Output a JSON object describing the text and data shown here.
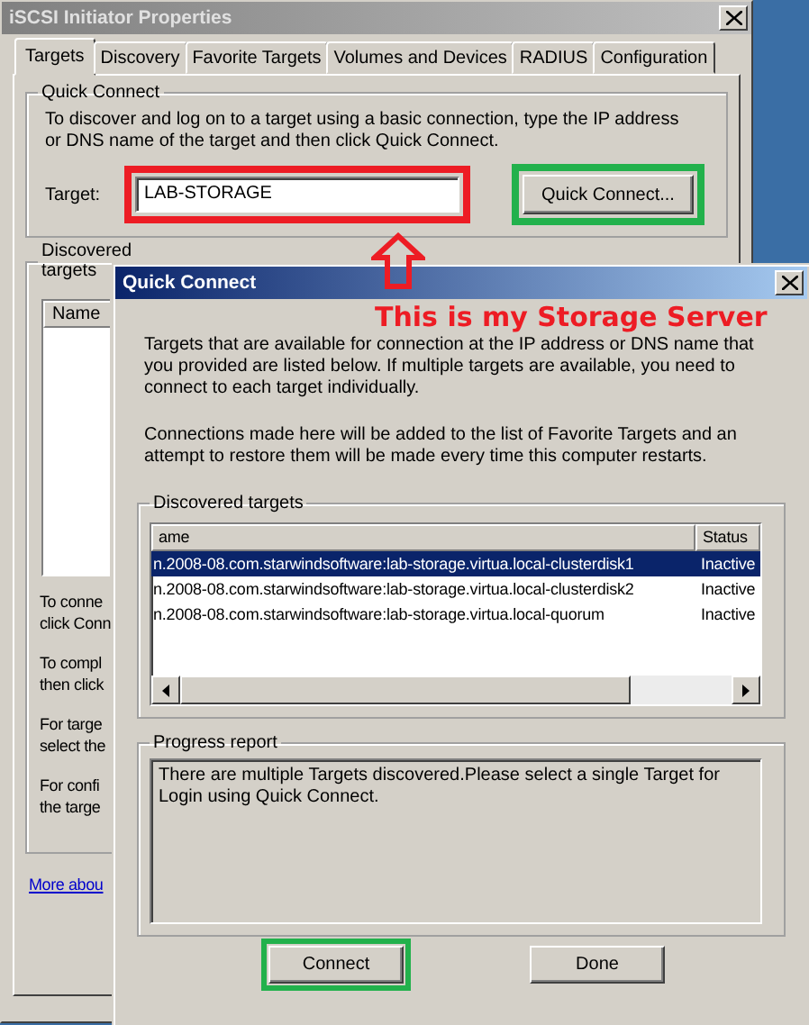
{
  "main_window": {
    "title": "iSCSI Initiator Properties",
    "tabs": [
      {
        "label": "Targets",
        "selected": true
      },
      {
        "label": "Discovery",
        "selected": false
      },
      {
        "label": "Favorite Targets",
        "selected": false
      },
      {
        "label": "Volumes and Devices",
        "selected": false
      },
      {
        "label": "RADIUS",
        "selected": false
      },
      {
        "label": "Configuration",
        "selected": false
      }
    ],
    "quick_connect": {
      "legend": "Quick Connect",
      "description": "To discover and log on to a target using a basic connection, type the IP address or DNS name of the target and then click Quick Connect.",
      "target_label": "Target:",
      "target_value": "LAB-STORAGE",
      "target_highlight": {
        "color": "#ed1c24"
      },
      "button": "Quick Connect...",
      "button_highlight": {
        "color": "#22b14c"
      }
    },
    "discovered_targets": {
      "legend": "Discovered targets",
      "column": "Name",
      "notes": [
        "To conne\nclick Conn",
        "To compl\nthen click",
        "For targe\nselect the",
        "For confi\nthe targe"
      ]
    },
    "link": "More abou"
  },
  "quick_connect_dialog": {
    "title": "Quick Connect",
    "intro": "Targets that are available for connection at the IP address or DNS name that you provided are listed below.  If multiple targets are available, you need to connect to each target individually.",
    "note": "Connections made here will be added to the list of Favorite Targets and an attempt to restore them will be made every time this computer restarts.",
    "discovered_targets": {
      "legend": "Discovered targets",
      "columns": [
        "ame",
        "Status"
      ],
      "rows": [
        {
          "name": "n.2008-08.com.starwindsoftware:lab-storage.virtua.local-clusterdisk1",
          "status": "Inactive",
          "selected": true
        },
        {
          "name": "n.2008-08.com.starwindsoftware:lab-storage.virtua.local-clusterdisk2",
          "status": "Inactive",
          "selected": false
        },
        {
          "name": "n.2008-08.com.starwindsoftware:lab-storage.virtua.local-quorum",
          "status": "Inactive",
          "selected": false
        }
      ]
    },
    "progress_report": {
      "legend": "Progress report",
      "message": "There are multiple Targets discovered.Please select a single Target for Login using Quick Connect."
    },
    "buttons": [
      {
        "label": "Connect",
        "highlight": {
          "color": "#22b14c"
        }
      },
      {
        "label": "Done"
      }
    ]
  },
  "annotation": {
    "label": "This is my Storage Server"
  }
}
